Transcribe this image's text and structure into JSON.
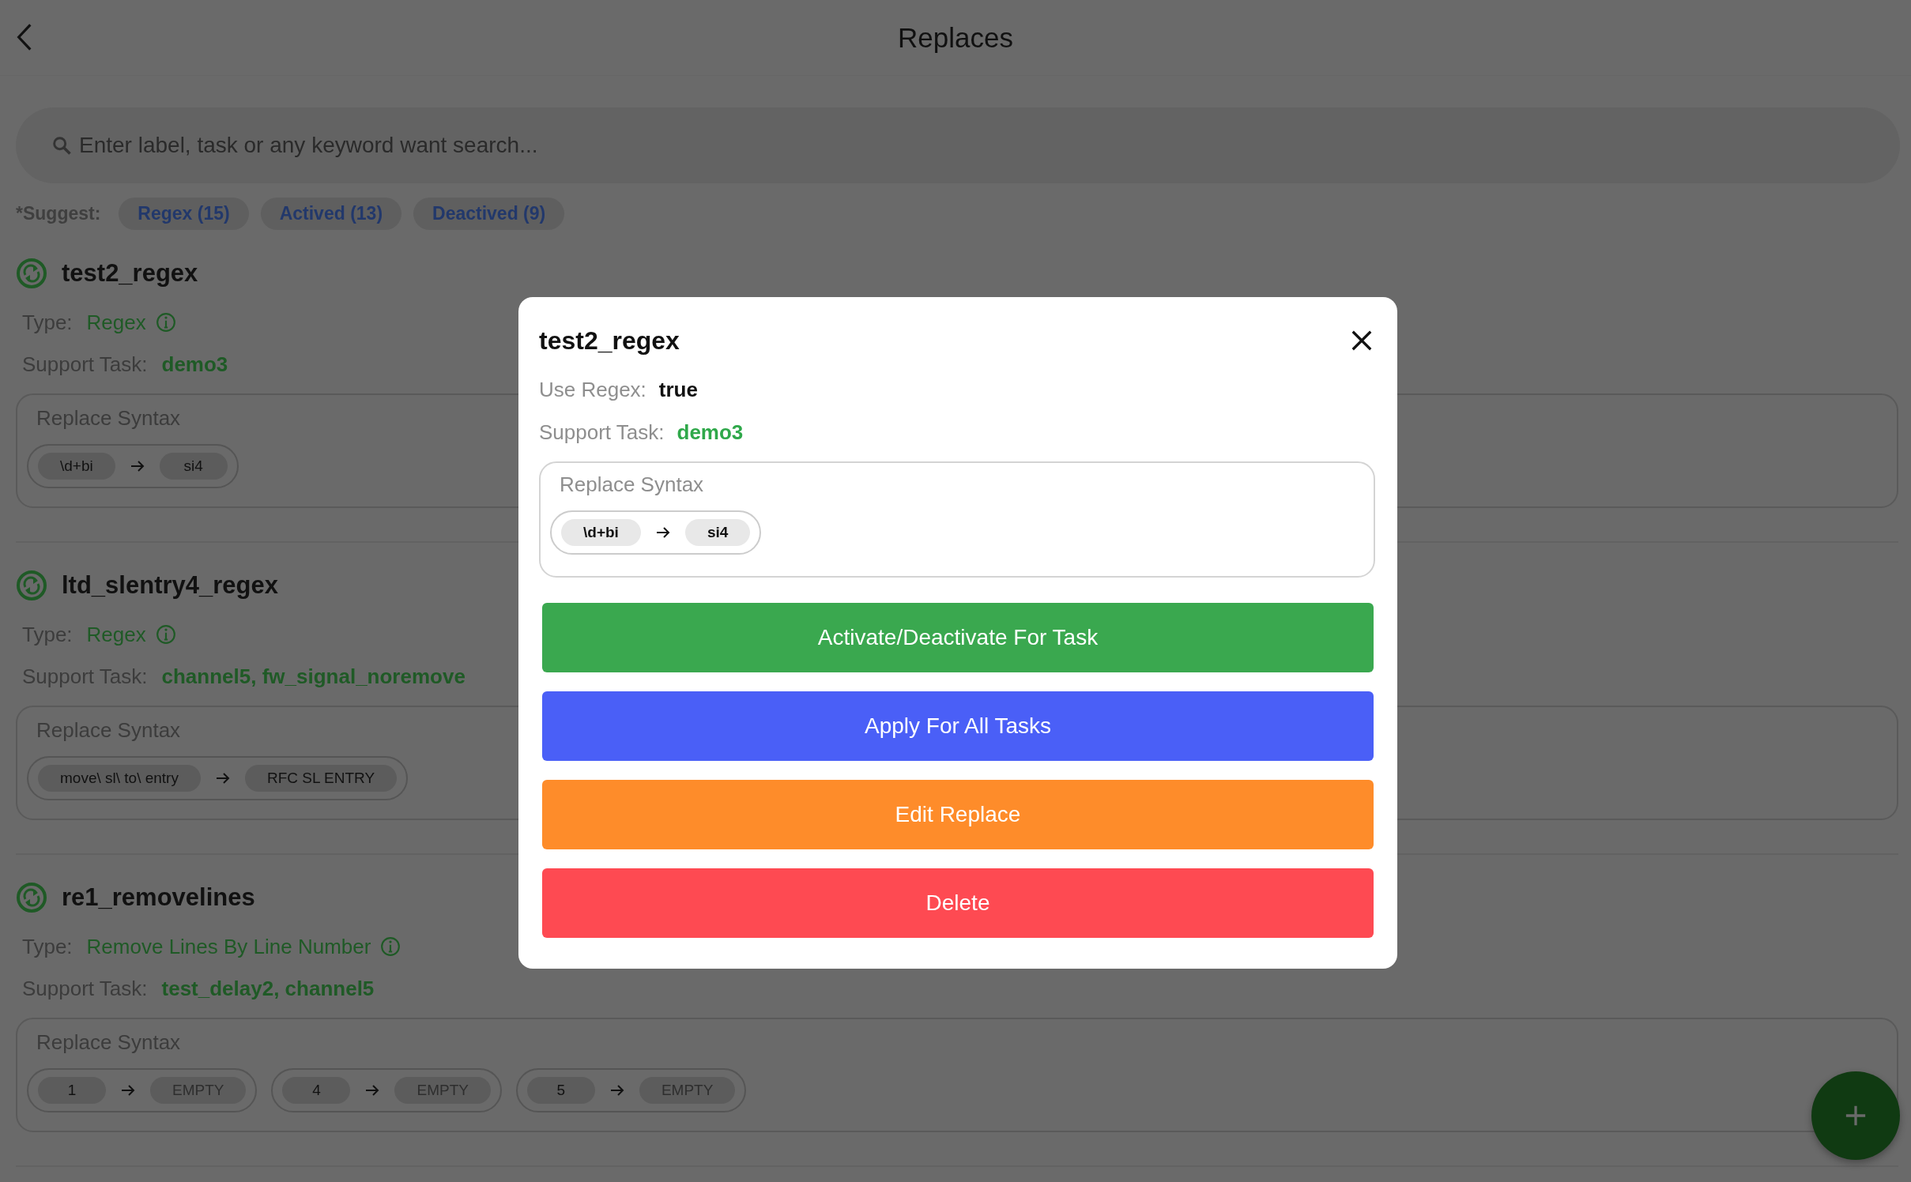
{
  "header": {
    "title": "Replaces"
  },
  "search": {
    "placeholder": "Enter label, task or any keyword want search..."
  },
  "suggest": {
    "label": "*Suggest:",
    "chips": [
      "Regex (15)",
      "Actived (13)",
      "Deactived (9)"
    ]
  },
  "items": [
    {
      "name": "test2_regex",
      "type_label": "Type:",
      "type": "Regex",
      "task_label": "Support Task:",
      "tasks": "demo3",
      "syntax_label": "Replace Syntax",
      "rules": [
        {
          "from": "\\d+bi",
          "to": "si4",
          "to_empty": false
        }
      ]
    },
    {
      "name": "ltd_slentry4_regex",
      "type_label": "Type:",
      "type": "Regex",
      "task_label": "Support Task:",
      "tasks": "channel5, fw_signal_noremove",
      "syntax_label": "Replace Syntax",
      "rules": [
        {
          "from": "move\\ sl\\ to\\ entry",
          "to": "RFC SL ENTRY",
          "to_empty": false
        }
      ]
    },
    {
      "name": "re1_removelines",
      "type_label": "Type:",
      "type": "Remove Lines By Line Number",
      "task_label": "Support Task:",
      "tasks": "test_delay2, channel5",
      "syntax_label": "Replace Syntax",
      "rules": [
        {
          "from": "1",
          "to": "EMPTY",
          "to_empty": true
        },
        {
          "from": "4",
          "to": "EMPTY",
          "to_empty": true
        },
        {
          "from": "5",
          "to": "EMPTY",
          "to_empty": true
        }
      ]
    }
  ],
  "dialog": {
    "title": "test2_regex",
    "regex_label": "Use Regex:",
    "regex_value": "true",
    "task_label": "Support Task:",
    "tasks": "demo3",
    "syntax_label": "Replace Syntax",
    "rules": [
      {
        "from": "\\d+bi",
        "to": "si4",
        "to_empty": false
      }
    ],
    "buttons": [
      {
        "label": "Activate/Deactivate For Task",
        "color": "#3aa84f"
      },
      {
        "label": "Apply For All Tasks",
        "color": "#4a5ff7"
      },
      {
        "label": "Edit Replace",
        "color": "#fe8c2a"
      },
      {
        "label": "Delete",
        "color": "#fe4a52"
      }
    ]
  }
}
